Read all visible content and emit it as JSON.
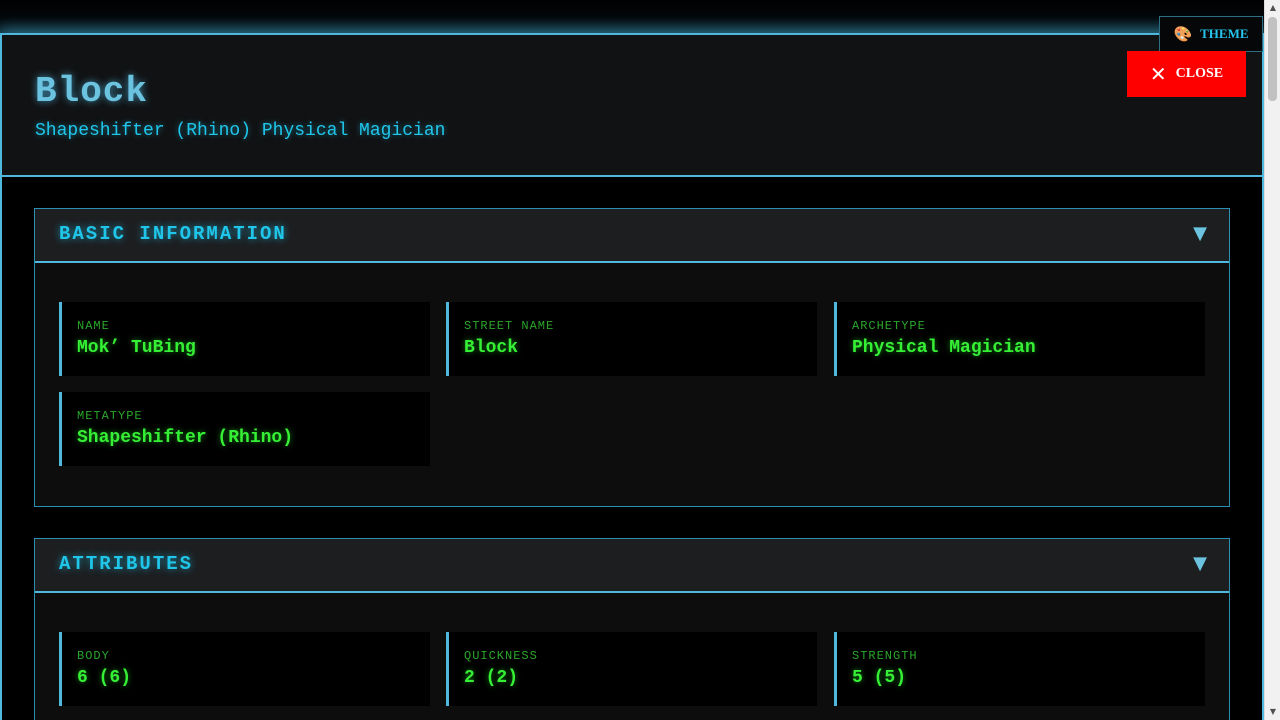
{
  "theme_button": {
    "icon": "palette-icon",
    "label": "THEME"
  },
  "close_button": {
    "icon": "close-icon",
    "label": "CLOSE"
  },
  "header": {
    "title": "Block",
    "subtitle": "Shapeshifter (Rhino) Physical Magician"
  },
  "sections": {
    "basic": {
      "title": "BASIC INFORMATION",
      "fields": [
        {
          "label": "NAME",
          "value": "Mok’ TuBing"
        },
        {
          "label": "STREET NAME",
          "value": "Block"
        },
        {
          "label": "ARCHETYPE",
          "value": "Physical Magician"
        },
        {
          "label": "METATYPE",
          "value": "Shapeshifter (Rhino)"
        }
      ]
    },
    "attributes": {
      "title": "ATTRIBUTES",
      "fields": [
        {
          "label": "BODY",
          "value": "6 (6)"
        },
        {
          "label": "QUICKNESS",
          "value": "2 (2)"
        },
        {
          "label": "STRENGTH",
          "value": "5 (5)"
        }
      ]
    }
  },
  "colors": {
    "accent": "#4fb8dc",
    "heading": "#1fc6ea",
    "value_green": "#35f035",
    "close_red": "#ff0000"
  }
}
